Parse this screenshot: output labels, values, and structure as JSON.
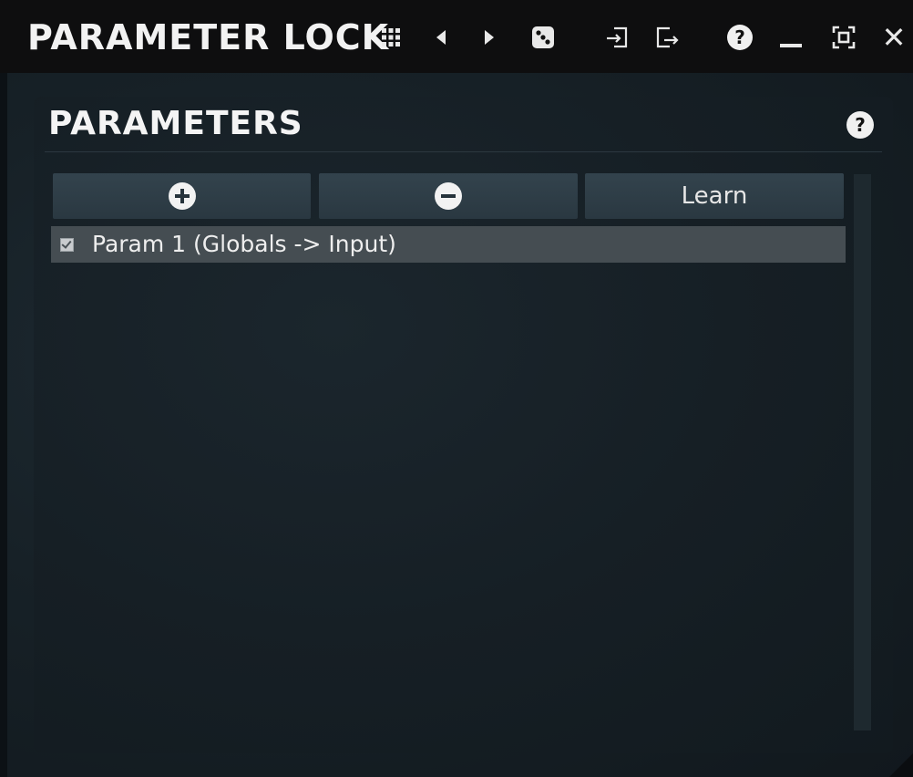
{
  "window": {
    "title": "PARAMETER LOCK",
    "toolbar_icons": [
      "grid-menu-icon",
      "previous-preset-icon",
      "next-preset-icon",
      "randomize-dice-icon",
      "import-icon",
      "export-icon",
      "help-icon",
      "minimize-icon",
      "fullscreen-icon",
      "close-icon"
    ],
    "help_symbol": "?",
    "close_symbol": "✕"
  },
  "panel": {
    "title": "PARAMETERS",
    "help_symbol": "?",
    "buttons": {
      "add_icon": "plus-circle-icon",
      "remove_icon": "minus-circle-icon",
      "learn_label": "Learn"
    },
    "items": [
      {
        "label": "Param 1 (Globals -> Input)",
        "checked": true
      }
    ]
  },
  "colors": {
    "titlebar_bg": "#0e0e0f",
    "panel_bg": "#161f25",
    "button_bg": "#2f3d46",
    "selected_row_bg": "#454d52",
    "text": "#eeeeee"
  }
}
